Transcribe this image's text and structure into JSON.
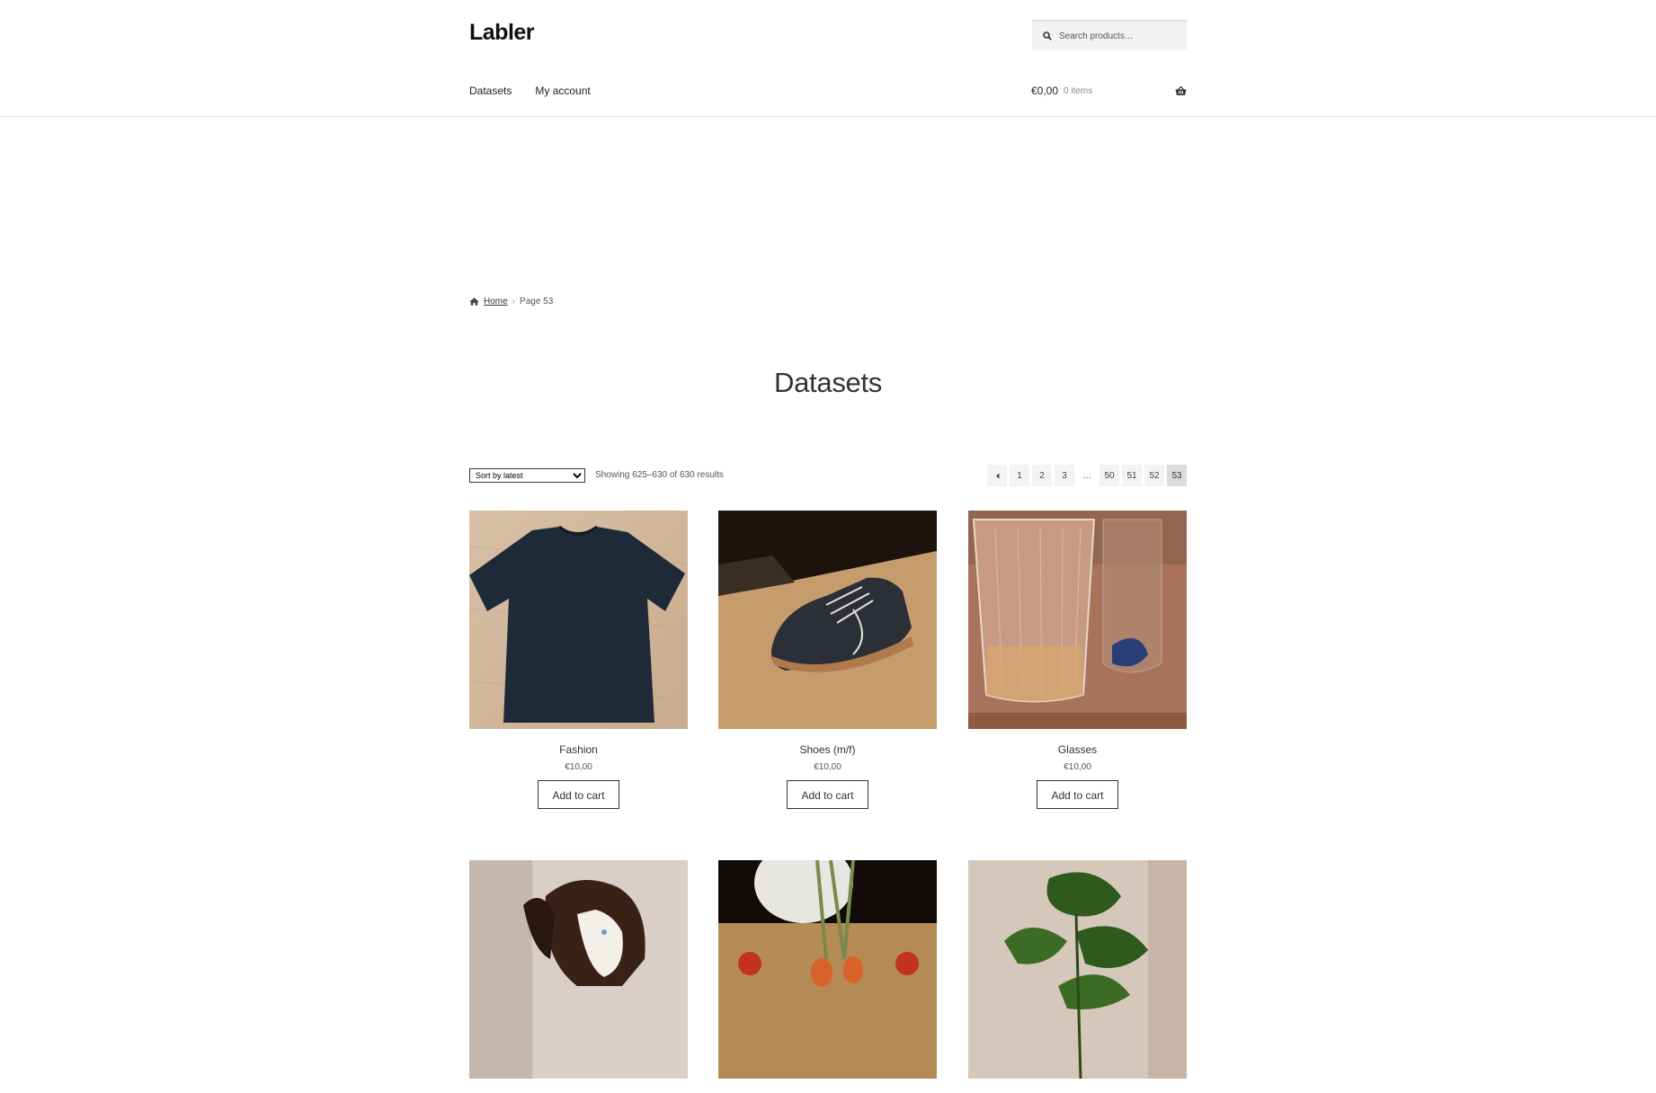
{
  "site": {
    "logo": "Labler"
  },
  "search": {
    "placeholder": "Search products…"
  },
  "nav": {
    "items": [
      {
        "label": "Datasets"
      },
      {
        "label": "My account"
      }
    ]
  },
  "cart": {
    "amount": "€0,00",
    "count": "0 items"
  },
  "breadcrumb": {
    "home": "Home",
    "current": "Page 53"
  },
  "page": {
    "title": "Datasets"
  },
  "toolbar": {
    "sort_selected": "Sort by latest",
    "result_count": "Showing 625–630 of 630 results"
  },
  "pagination": {
    "pages": [
      "1",
      "2",
      "3",
      "…",
      "50",
      "51",
      "52",
      "53"
    ],
    "current": "53"
  },
  "products": [
    {
      "title": "Fashion",
      "price": "€10,00",
      "button": "Add to cart",
      "image": "dark-tshirt-on-wood-floor"
    },
    {
      "title": "Shoes (m/f)",
      "price": "€10,00",
      "button": "Add to cart",
      "image": "dark-shoe-on-wood-floor"
    },
    {
      "title": "Glasses",
      "price": "€10,00",
      "button": "Add to cart",
      "image": "glass-tumbler-on-table"
    },
    {
      "title": "",
      "price": "",
      "button": "",
      "image": "dog-portrait"
    },
    {
      "title": "",
      "price": "",
      "button": "",
      "image": "vegetables-with-plant"
    },
    {
      "title": "",
      "price": "",
      "button": "",
      "image": "fig-plant-leaves"
    }
  ],
  "colors": {
    "border": "#e6e6e6",
    "search_bg": "#f2f2f2",
    "page_current_bg": "#dcdcdc",
    "page_bg": "#f3f3f3"
  }
}
